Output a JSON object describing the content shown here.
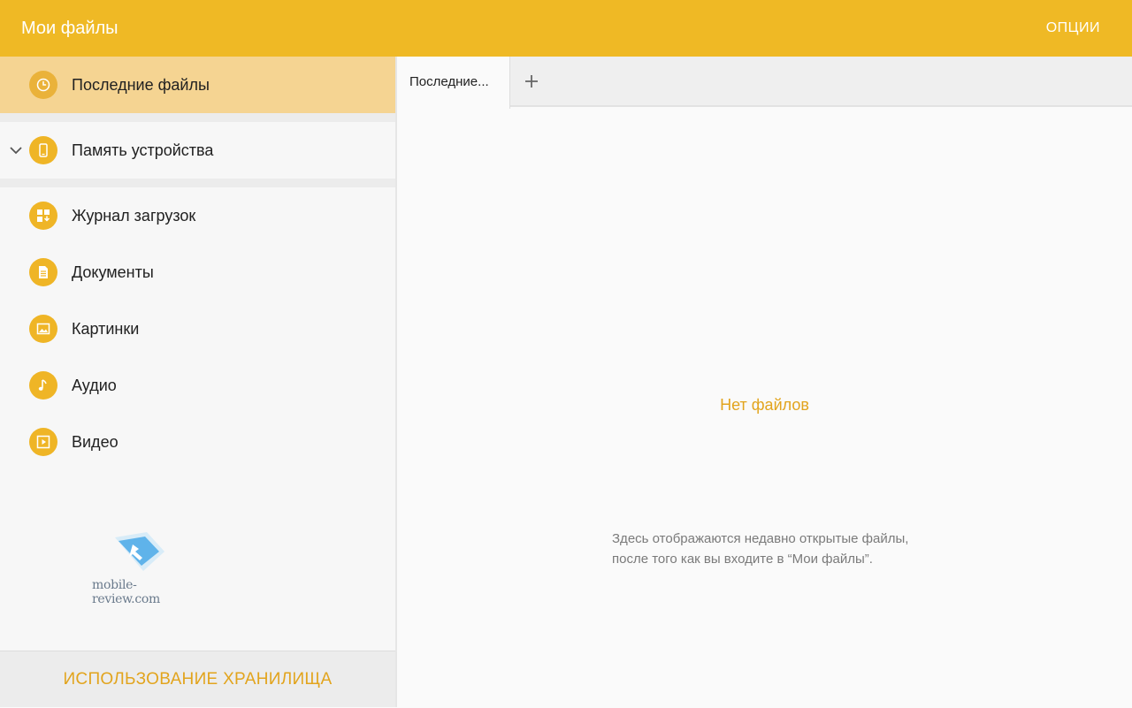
{
  "appbar": {
    "title": "Мои файлы",
    "options_label": "ОПЦИИ"
  },
  "sidebar": {
    "recent": {
      "label": "Последние файлы",
      "icon": "clock-icon",
      "selected": true
    },
    "device_storage": {
      "label": "Память устройства",
      "icon": "phone-icon",
      "expanded": true
    },
    "categories": [
      {
        "label": "Журнал загрузок",
        "icon": "download-history-icon"
      },
      {
        "label": "Документы",
        "icon": "document-icon"
      },
      {
        "label": "Картинки",
        "icon": "image-icon"
      },
      {
        "label": "Аудио",
        "icon": "music-note-icon"
      },
      {
        "label": "Видео",
        "icon": "video-icon"
      }
    ],
    "storage_usage_label": "ИСПОЛЬЗОВАНИЕ ХРАНИЛИЩА"
  },
  "watermark": {
    "text": "mobile-review.com"
  },
  "tabs": [
    {
      "label": "Последние...",
      "active": true
    }
  ],
  "main": {
    "empty_title": "Нет файлов",
    "empty_description": "Здесь отображаются недавно открытые файлы, после того как вы входите в “Мои файлы”."
  },
  "colors": {
    "accent": "#efb925",
    "selected_row": "#f5d492",
    "accent_text": "#e2a41d"
  }
}
